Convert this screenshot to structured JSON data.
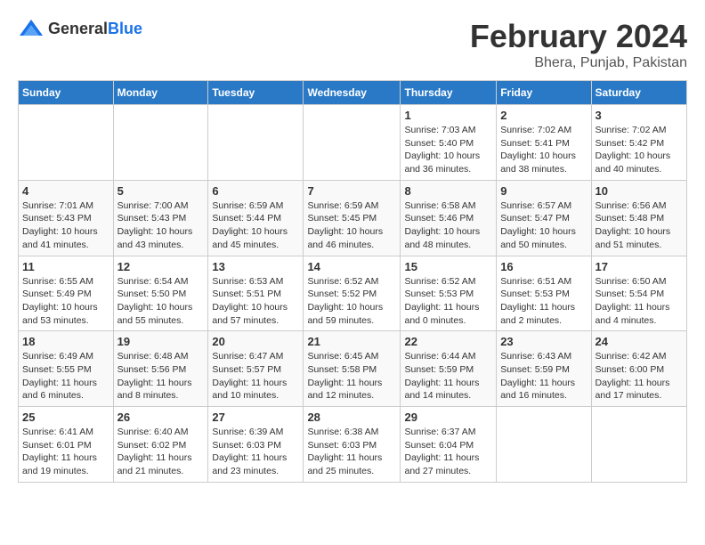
{
  "header": {
    "logo_general": "General",
    "logo_blue": "Blue",
    "month_year": "February 2024",
    "location": "Bhera, Punjab, Pakistan"
  },
  "weekdays": [
    "Sunday",
    "Monday",
    "Tuesday",
    "Wednesday",
    "Thursday",
    "Friday",
    "Saturday"
  ],
  "weeks": [
    [
      {
        "day": "",
        "info": ""
      },
      {
        "day": "",
        "info": ""
      },
      {
        "day": "",
        "info": ""
      },
      {
        "day": "",
        "info": ""
      },
      {
        "day": "1",
        "info": "Sunrise: 7:03 AM\nSunset: 5:40 PM\nDaylight: 10 hours\nand 36 minutes."
      },
      {
        "day": "2",
        "info": "Sunrise: 7:02 AM\nSunset: 5:41 PM\nDaylight: 10 hours\nand 38 minutes."
      },
      {
        "day": "3",
        "info": "Sunrise: 7:02 AM\nSunset: 5:42 PM\nDaylight: 10 hours\nand 40 minutes."
      }
    ],
    [
      {
        "day": "4",
        "info": "Sunrise: 7:01 AM\nSunset: 5:43 PM\nDaylight: 10 hours\nand 41 minutes."
      },
      {
        "day": "5",
        "info": "Sunrise: 7:00 AM\nSunset: 5:43 PM\nDaylight: 10 hours\nand 43 minutes."
      },
      {
        "day": "6",
        "info": "Sunrise: 6:59 AM\nSunset: 5:44 PM\nDaylight: 10 hours\nand 45 minutes."
      },
      {
        "day": "7",
        "info": "Sunrise: 6:59 AM\nSunset: 5:45 PM\nDaylight: 10 hours\nand 46 minutes."
      },
      {
        "day": "8",
        "info": "Sunrise: 6:58 AM\nSunset: 5:46 PM\nDaylight: 10 hours\nand 48 minutes."
      },
      {
        "day": "9",
        "info": "Sunrise: 6:57 AM\nSunset: 5:47 PM\nDaylight: 10 hours\nand 50 minutes."
      },
      {
        "day": "10",
        "info": "Sunrise: 6:56 AM\nSunset: 5:48 PM\nDaylight: 10 hours\nand 51 minutes."
      }
    ],
    [
      {
        "day": "11",
        "info": "Sunrise: 6:55 AM\nSunset: 5:49 PM\nDaylight: 10 hours\nand 53 minutes."
      },
      {
        "day": "12",
        "info": "Sunrise: 6:54 AM\nSunset: 5:50 PM\nDaylight: 10 hours\nand 55 minutes."
      },
      {
        "day": "13",
        "info": "Sunrise: 6:53 AM\nSunset: 5:51 PM\nDaylight: 10 hours\nand 57 minutes."
      },
      {
        "day": "14",
        "info": "Sunrise: 6:52 AM\nSunset: 5:52 PM\nDaylight: 10 hours\nand 59 minutes."
      },
      {
        "day": "15",
        "info": "Sunrise: 6:52 AM\nSunset: 5:53 PM\nDaylight: 11 hours\nand 0 minutes."
      },
      {
        "day": "16",
        "info": "Sunrise: 6:51 AM\nSunset: 5:53 PM\nDaylight: 11 hours\nand 2 minutes."
      },
      {
        "day": "17",
        "info": "Sunrise: 6:50 AM\nSunset: 5:54 PM\nDaylight: 11 hours\nand 4 minutes."
      }
    ],
    [
      {
        "day": "18",
        "info": "Sunrise: 6:49 AM\nSunset: 5:55 PM\nDaylight: 11 hours\nand 6 minutes."
      },
      {
        "day": "19",
        "info": "Sunrise: 6:48 AM\nSunset: 5:56 PM\nDaylight: 11 hours\nand 8 minutes."
      },
      {
        "day": "20",
        "info": "Sunrise: 6:47 AM\nSunset: 5:57 PM\nDaylight: 11 hours\nand 10 minutes."
      },
      {
        "day": "21",
        "info": "Sunrise: 6:45 AM\nSunset: 5:58 PM\nDaylight: 11 hours\nand 12 minutes."
      },
      {
        "day": "22",
        "info": "Sunrise: 6:44 AM\nSunset: 5:59 PM\nDaylight: 11 hours\nand 14 minutes."
      },
      {
        "day": "23",
        "info": "Sunrise: 6:43 AM\nSunset: 5:59 PM\nDaylight: 11 hours\nand 16 minutes."
      },
      {
        "day": "24",
        "info": "Sunrise: 6:42 AM\nSunset: 6:00 PM\nDaylight: 11 hours\nand 17 minutes."
      }
    ],
    [
      {
        "day": "25",
        "info": "Sunrise: 6:41 AM\nSunset: 6:01 PM\nDaylight: 11 hours\nand 19 minutes."
      },
      {
        "day": "26",
        "info": "Sunrise: 6:40 AM\nSunset: 6:02 PM\nDaylight: 11 hours\nand 21 minutes."
      },
      {
        "day": "27",
        "info": "Sunrise: 6:39 AM\nSunset: 6:03 PM\nDaylight: 11 hours\nand 23 minutes."
      },
      {
        "day": "28",
        "info": "Sunrise: 6:38 AM\nSunset: 6:03 PM\nDaylight: 11 hours\nand 25 minutes."
      },
      {
        "day": "29",
        "info": "Sunrise: 6:37 AM\nSunset: 6:04 PM\nDaylight: 11 hours\nand 27 minutes."
      },
      {
        "day": "",
        "info": ""
      },
      {
        "day": "",
        "info": ""
      }
    ]
  ]
}
